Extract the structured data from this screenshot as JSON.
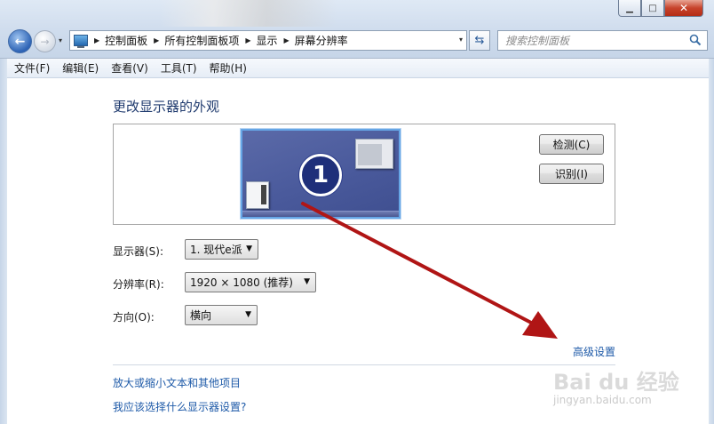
{
  "window": {
    "minimize_glyph": "▁",
    "maximize_glyph": "□",
    "close_glyph": "✕"
  },
  "navigation": {
    "back_glyph": "←",
    "forward_glyph": "→",
    "history_glyph": "▾",
    "refresh_glyph": "⇆"
  },
  "address_bar": {
    "breadcrumbs": [
      "控制面板",
      "所有控制面板项",
      "显示",
      "屏幕分辨率"
    ],
    "separator_glyph": "▶",
    "dropdown_glyph": "▾"
  },
  "search": {
    "placeholder": "搜索控制面板",
    "icon": "search-icon"
  },
  "menu": [
    "文件(F)",
    "编辑(E)",
    "查看(V)",
    "工具(T)",
    "帮助(H)"
  ],
  "main": {
    "title": "更改显示器的外观",
    "monitor_number": "1",
    "detect_button": "检测(C)",
    "identify_button": "识别(I)"
  },
  "form": {
    "display_label": "显示器(S):",
    "display_value": "1. 现代e派",
    "resolution_label": "分辨率(R):",
    "resolution_value": "1920 × 1080 (推荐)",
    "orientation_label": "方向(O):",
    "orientation_value": "横向",
    "dropdown_glyph": "▼"
  },
  "links": {
    "advanced": "高级设置",
    "text_size": "放大或缩小文本和其他项目",
    "which_settings": "我应该选择什么显示器设置?"
  },
  "watermark": {
    "brand": "Bai du 经验",
    "url": "jingyan.baidu.com"
  },
  "colors": {
    "annotation_arrow": "#b01515",
    "link": "#1e5aa8",
    "title": "#1f3a6e"
  }
}
